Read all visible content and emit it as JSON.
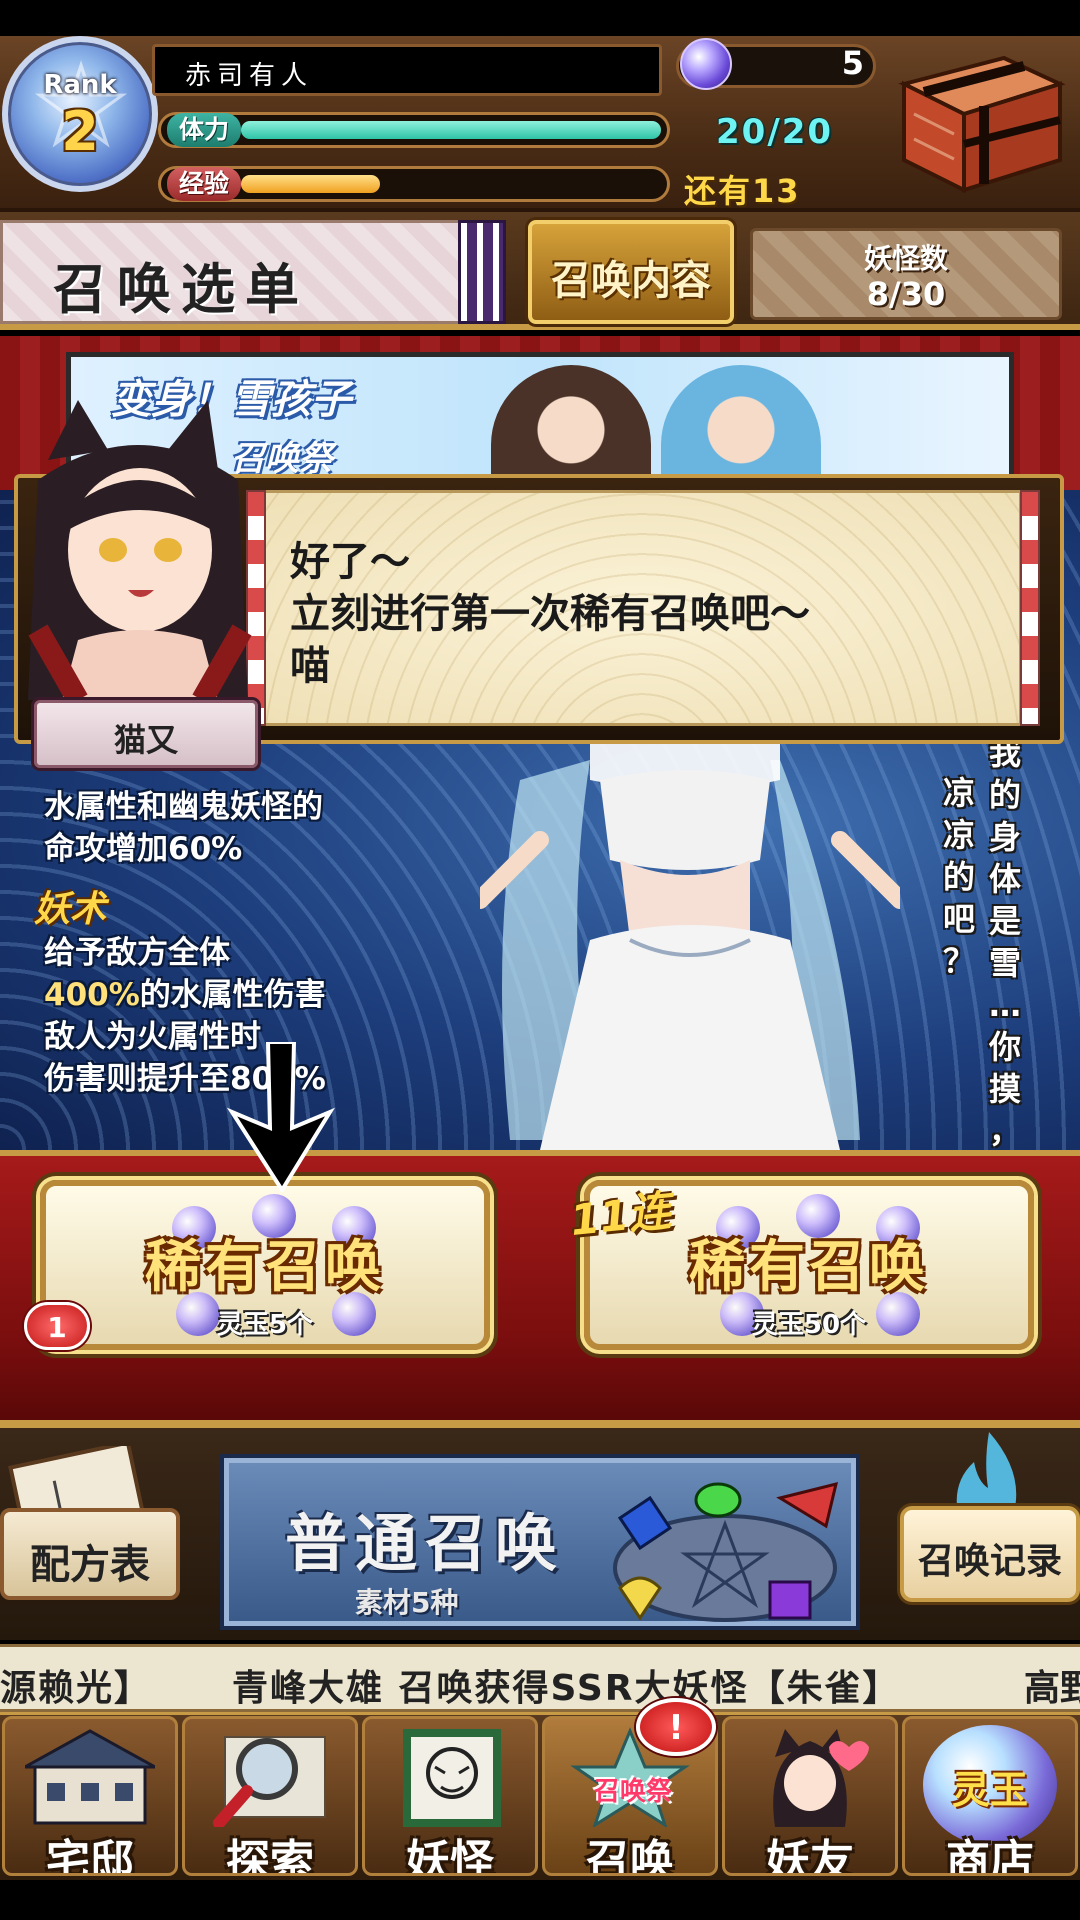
{
  "player": {
    "rank_label": "Rank",
    "rank": "2",
    "name": "赤司有人",
    "stamina_label": "体力",
    "stamina_text": "20/20",
    "stamina_fraction": 1.0,
    "exp_label": "经验",
    "exp_remaining": "还有13",
    "exp_fraction": 0.33,
    "spirit_orbs": "5"
  },
  "tabs": {
    "menu_title": "召唤选单",
    "summon_content": "召唤内容",
    "yokai_count_title": "妖怪数",
    "yokai_count": "8/30"
  },
  "banner": {
    "title": "变身！雪孩子",
    "subtitle": "召唤祭"
  },
  "feature": {
    "passive_text": [
      "水属性和幽鬼妖怪的",
      "命攻增加60%"
    ],
    "skill_label": "妖术",
    "skill_line1": "给予敌方全体",
    "skill_pct": "400%",
    "skill_line2_suffix": "的水属性伤害",
    "skill_line3": "敌人为火属性时",
    "skill_line4": "伤害则提升至800%",
    "quote_columns": [
      "凉凉的吧？",
      "我的身体是雪…你摸，"
    ]
  },
  "dialog": {
    "speaker": "猫又",
    "lines": [
      "好了～",
      "立刻进行第一次稀有召唤吧～",
      "喵"
    ]
  },
  "summon": {
    "rare_title": "稀有召唤",
    "rare_cost": "灵玉5个",
    "rare_badge": "1",
    "rare11_tag": "11连",
    "rare11_title": "稀有召唤",
    "rare11_cost": "灵玉50个"
  },
  "lower_menu": {
    "recipe": "配方表",
    "normal_summon_title": "普通召唤",
    "normal_summon_cost": "素材5种",
    "history": "召唤记录"
  },
  "ticker": {
    "prev": "源赖光】",
    "message": "青峰大雄 召唤获得SSR大妖怪【朱雀】",
    "next": "高野"
  },
  "bottom_nav": {
    "items": [
      "宅邸",
      "探索",
      "妖怪",
      "召唤",
      "妖友",
      "商店"
    ],
    "summon_tag": "召唤祭",
    "alert": "!",
    "shop_orb": "灵玉"
  },
  "colors": {
    "stamina": "#2fc4a7",
    "exp": "#f0a020",
    "accent_gold": "#c79b45",
    "summon_red": "#a61a1a"
  }
}
